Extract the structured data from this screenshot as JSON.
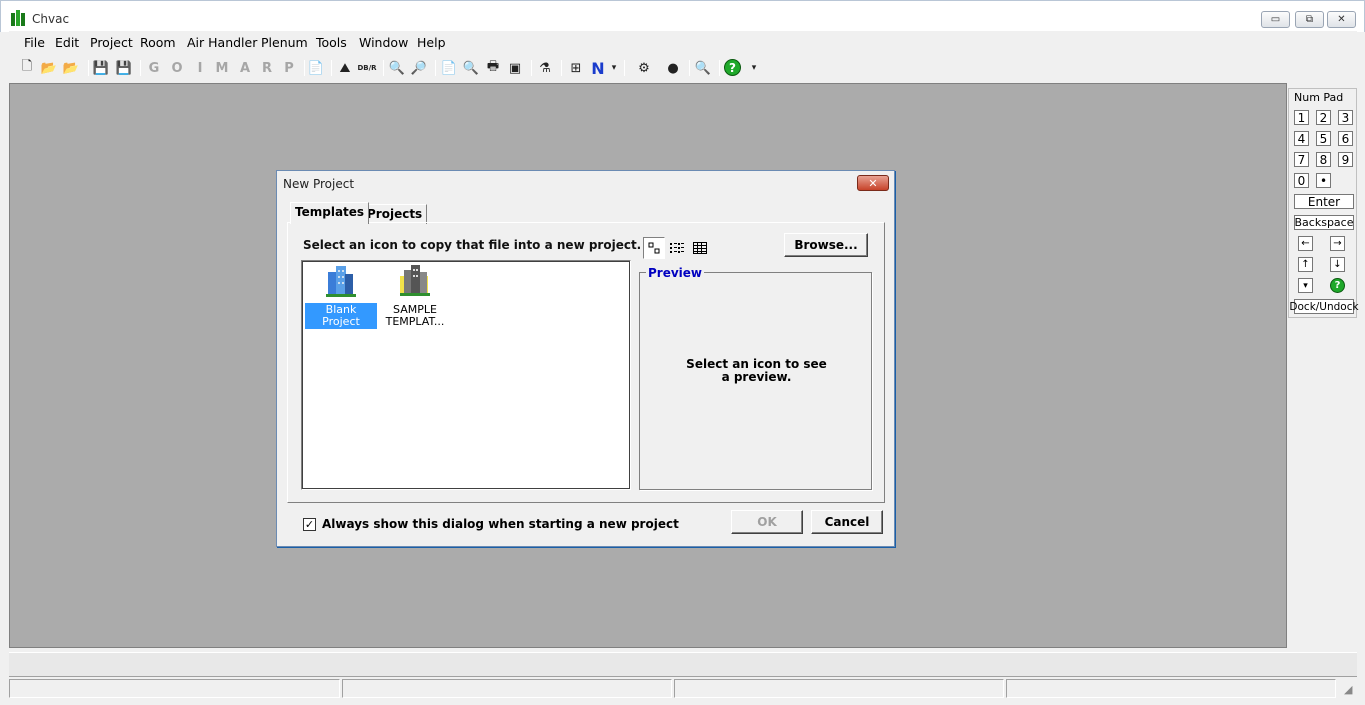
{
  "window": {
    "title": "Chvac",
    "controls": [
      "minimize-icon",
      "maximize-icon",
      "close-icon"
    ]
  },
  "menubar": {
    "items": [
      {
        "label": "File"
      },
      {
        "label": "Edit"
      },
      {
        "label": "Project"
      },
      {
        "label": "Room"
      },
      {
        "label": "Air Handler"
      },
      {
        "label": "Plenum"
      },
      {
        "label": "Tools"
      },
      {
        "label": "Window"
      },
      {
        "label": "Help"
      }
    ]
  },
  "toolbar": {
    "letters": [
      "G",
      "O",
      "I",
      "M",
      "A",
      "R",
      "P"
    ],
    "n_label": "N",
    "dr_label": "DB/R",
    "help_glyph": "?"
  },
  "numpad": {
    "title": "Num Pad",
    "keys": [
      "1",
      "2",
      "3",
      "4",
      "5",
      "6",
      "7",
      "8",
      "9",
      "0",
      "•"
    ],
    "enter": "Enter",
    "backspace": "Backspace",
    "arrows": [
      "←",
      "→",
      "↑",
      "↓"
    ],
    "dock": "Dock/Undock",
    "help_glyph": "?"
  },
  "dialog": {
    "title": "New Project",
    "close_glyph": "✕",
    "tabs": [
      {
        "label": "Templates",
        "active": true
      },
      {
        "label": "Projects",
        "active": false
      }
    ],
    "instruction": "Select an icon to copy that file into a new project.",
    "browse_label": "Browse...",
    "list_items": [
      {
        "label": "Blank Project",
        "selected": true
      },
      {
        "label": "SAMPLE TEMPLAT...",
        "selected": false
      }
    ],
    "preview": {
      "label": "Preview",
      "text": "Select an icon to see a preview."
    },
    "checkbox": {
      "label": "Always show this dialog when starting a new project",
      "checked": true,
      "mark": "✓"
    },
    "ok_label": "OK",
    "cancel_label": "Cancel"
  }
}
